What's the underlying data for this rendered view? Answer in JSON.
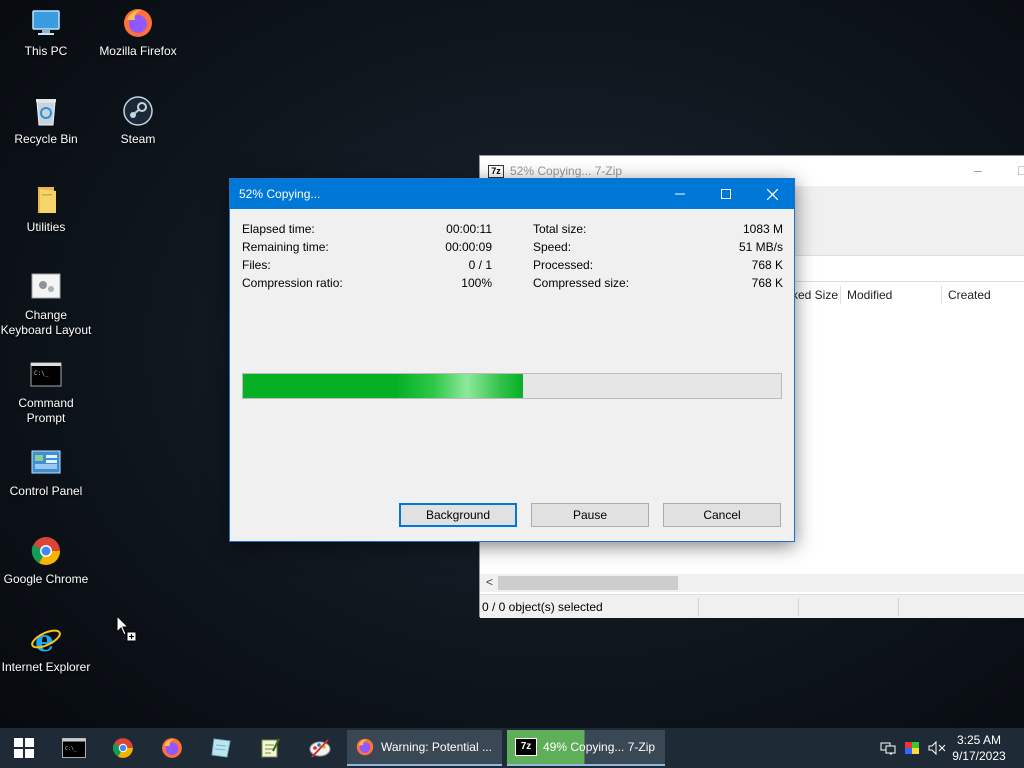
{
  "desktop": {
    "icons": [
      {
        "label": "This PC",
        "icon": "computer-icon"
      },
      {
        "label": "Mozilla Firefox",
        "icon": "firefox-icon"
      },
      {
        "label": "Recycle Bin",
        "icon": "recycle-bin-icon"
      },
      {
        "label": "Steam",
        "icon": "steam-icon"
      },
      {
        "label": "Utilities",
        "icon": "folder-icon"
      },
      {
        "label": "Change\nKeyboard Layout",
        "icon": "keyboard-settings-icon"
      },
      {
        "label": "Command\nPrompt",
        "icon": "cmd-icon"
      },
      {
        "label": "Control Panel",
        "icon": "control-panel-icon"
      },
      {
        "label": "Google Chrome",
        "icon": "chrome-icon"
      },
      {
        "label": "Internet Explorer",
        "icon": "ie-icon"
      }
    ]
  },
  "bg_window": {
    "badge": "7z",
    "title": "52% Copying... 7-Zip",
    "columns": [
      "ked Size",
      "Modified",
      "Created"
    ],
    "scroll_left": "<",
    "status": "0 / 0 object(s) selected"
  },
  "dialog": {
    "title": "52% Copying...",
    "left_info": [
      {
        "label": "Elapsed time:",
        "value": "00:00:11"
      },
      {
        "label": "Remaining time:",
        "value": "00:00:09"
      },
      {
        "label": "Files:",
        "value": "0 / 1"
      },
      {
        "label": "Compression ratio:",
        "value": "100%"
      }
    ],
    "right_info": [
      {
        "label": "Total size:",
        "value": "1083 M"
      },
      {
        "label": "Speed:",
        "value": "51 MB/s"
      },
      {
        "label": "Processed:",
        "value": "768 K"
      },
      {
        "label": "Compressed size:",
        "value": "768 K"
      }
    ],
    "progress_fraction": 0.52,
    "buttons": {
      "background": "Background",
      "pause": "Pause",
      "cancel": "Cancel"
    }
  },
  "taskbar": {
    "tasks": [
      {
        "label": "Warning: Potential ...",
        "icon": "firefox-icon"
      },
      {
        "badge": "7z",
        "label": "49% Copying... 7-Zip",
        "progress_fraction": 0.49
      }
    ],
    "clock": {
      "time": "3:25 AM",
      "date": "9/17/2023"
    }
  },
  "colors": {
    "accent": "#0078d7",
    "progress_green": "#06b025",
    "taskbar": "#1e2a35"
  }
}
